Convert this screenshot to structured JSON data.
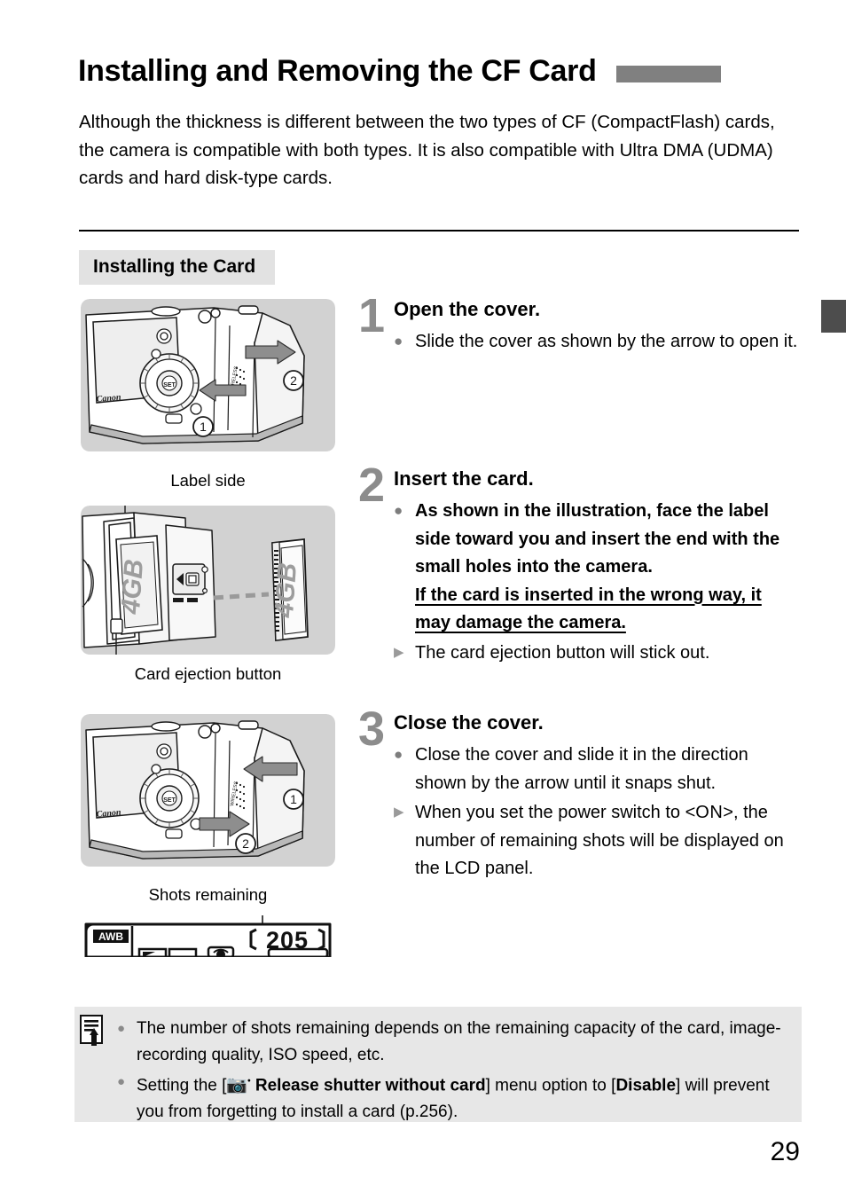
{
  "header": {
    "title": "Installing and Removing the CF Card",
    "bar_color": "#808080"
  },
  "intro": "Although the thickness is different between the two types of CF (CompactFlash) cards, the camera is compatible with both types. It is also compatible with Ultra DMA (UDMA) cards and hard disk-type cards.",
  "section": {
    "heading": "Installing the Card",
    "heading_bg": "#e2e2e2"
  },
  "edge_tab": {
    "color": "#4d4d4d"
  },
  "figures": {
    "step1": {
      "name": "camera-back-cover-open",
      "bg": "#d2d2d2",
      "brand": "Canon",
      "set_label": "SET",
      "callout_1": "1",
      "callout_2": "2"
    },
    "step2": {
      "name": "cf-card-insertion",
      "bg": "#d2d2d2",
      "card_label": "4GB",
      "caption_top": "Label side",
      "caption_bottom": "Card ejection button"
    },
    "step3": {
      "name": "camera-back-cover-close",
      "bg": "#d2d2d2",
      "brand": "Canon",
      "set_label": "SET",
      "callout_1": "1",
      "callout_2": "2",
      "caption": "Shots remaining"
    },
    "lcd_panel": {
      "name": "lcd-panel-preview",
      "awb": "AWB",
      "shots_remaining": "205"
    }
  },
  "steps": [
    {
      "number": "1",
      "title": "Open the cover.",
      "bullets": [
        {
          "mark": "bullet",
          "text": "Slide the cover as shown by the arrow to open it.",
          "bold": false
        }
      ]
    },
    {
      "number": "2",
      "title": "Insert the card.",
      "bullets": [
        {
          "mark": "bullet",
          "bold": true,
          "text": "As shown in the illustration, face the label side toward you and insert the end with the small holes into the camera.",
          "underlined": "If the card is inserted in the wrong way, it may damage the camera."
        },
        {
          "mark": "triangle",
          "text": "The card ejection button will stick out.",
          "bold": false
        }
      ]
    },
    {
      "number": "3",
      "title": "Close the cover.",
      "bullets": [
        {
          "mark": "bullet",
          "text": "Close the cover and slide it in the direction shown by the arrow until it snaps shut.",
          "bold": false
        },
        {
          "mark": "triangle",
          "text_before": "When you set the power switch to <",
          "power_on": "ON",
          "text_after": ">, the number of remaining shots will be displayed on the LCD panel.",
          "bold": false
        }
      ]
    }
  ],
  "note": {
    "bg": "#e7e7e7",
    "icon_name": "memo-note-icon",
    "items": [
      {
        "text": "The number of shots remaining depends on the remaining capacity of the card, image-recording quality, ISO speed, etc."
      },
      {
        "prefix": "Setting the [",
        "menu_icon": "shooting-menu-1-icon",
        "menu_name": "Release shutter without card",
        "middle": "] menu option to [",
        "option": "Disable",
        "suffix": "] will prevent you from forgetting to install a card (p.256)."
      }
    ]
  },
  "page_number": "29"
}
